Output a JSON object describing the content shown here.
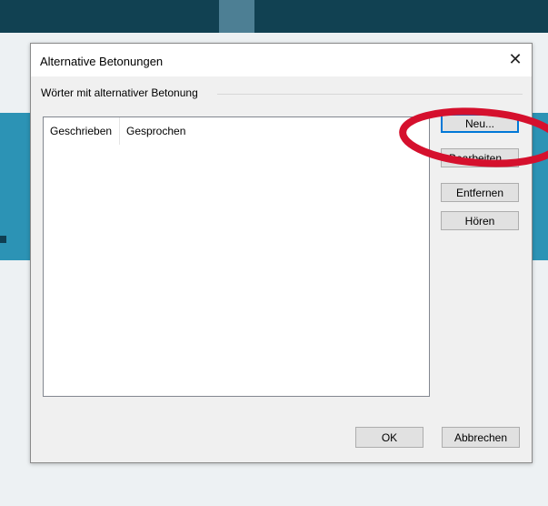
{
  "dialog": {
    "title": "Alternative Betonungen",
    "close_symbol": "✕",
    "group_label": "Wörter mit alternativer Betonung",
    "list": {
      "columns": [
        "Geschrieben",
        "Gesprochen"
      ],
      "rows": []
    },
    "buttons": {
      "new": "Neu...",
      "edit": "Bearbeiten...",
      "remove": "Entfernen",
      "listen": "Hören",
      "ok": "OK",
      "cancel": "Abbrechen"
    }
  },
  "annotation": {
    "shape": "ellipse",
    "color": "#d5102d",
    "target": "Neu..."
  },
  "colors": {
    "top_bar": "#114152",
    "teal_band": "#2c93b5",
    "focus": "#0078d7"
  },
  "icons": [
    "close-icon"
  ]
}
